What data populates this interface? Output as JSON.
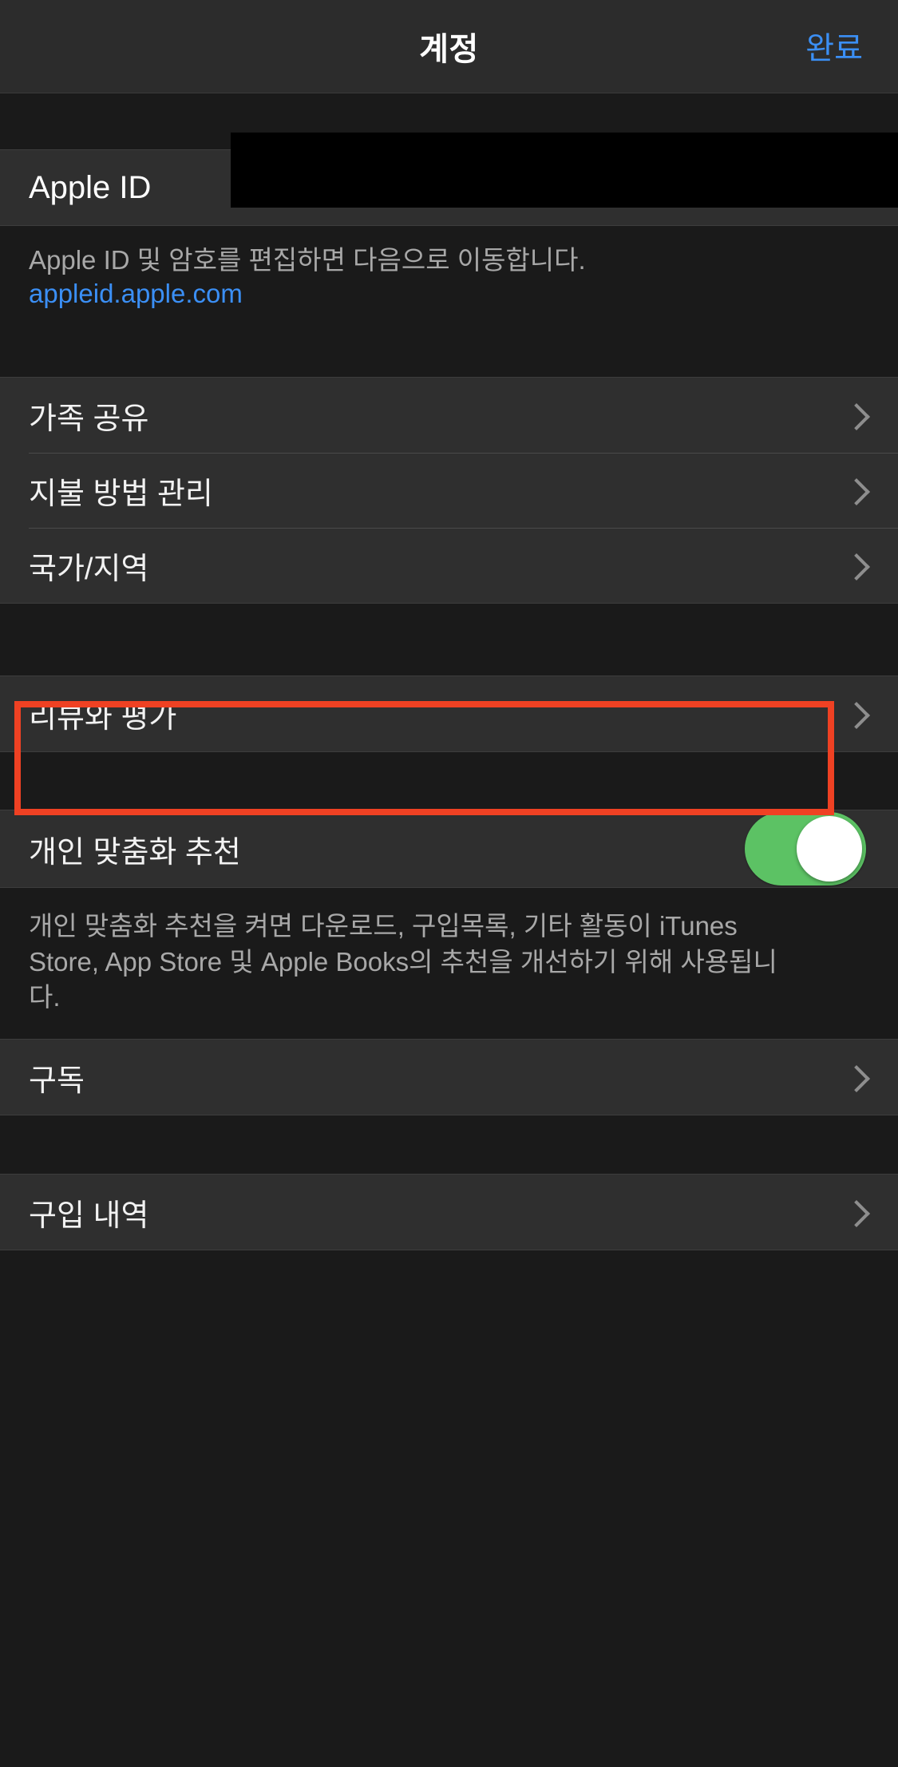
{
  "navbar": {
    "title": "계정",
    "done_label": "완료"
  },
  "account_section": {
    "apple_id_label": "Apple ID",
    "apple_id_value": "",
    "apple_id_redacted": true,
    "footnote_text": "Apple ID 및 암호를 편집하면 다음으로 이동합니다.",
    "footnote_link": "appleid.apple.com"
  },
  "settings_group_1": {
    "rows": [
      {
        "label": "가족 공유",
        "accessory": "chevron-right"
      },
      {
        "label": "지불 방법 관리",
        "accessory": "chevron-right"
      },
      {
        "label": "국가/지역",
        "accessory": "chevron-right",
        "highlighted": true
      }
    ]
  },
  "settings_group_2": {
    "rows": [
      {
        "label": "리뷰와 평가",
        "accessory": "chevron-right"
      }
    ]
  },
  "settings_group_3": {
    "rows": [
      {
        "label": "개인 맞춤화 추천",
        "accessory": "toggle",
        "toggle_on": true
      }
    ],
    "footnote": "개인 맞춤화 추천을 켜면 다운로드, 구입목록, 기타 활동이 iTunes Store, App Store 및 Apple Books의 추천을 개선하기 위해 사용됩니다."
  },
  "settings_group_4": {
    "rows": [
      {
        "label": "구독",
        "accessory": "chevron-right"
      }
    ]
  },
  "settings_group_5": {
    "rows": [
      {
        "label": "구입 내역",
        "accessory": "chevron-right"
      }
    ]
  },
  "colors": {
    "accent_blue": "#3b8ff5",
    "toggle_green": "#5cc264",
    "highlight_red": "#ef4123",
    "row_background": "#2f2f2f",
    "page_background": "#1a1a1a",
    "navbar_background": "#2c2c2c"
  }
}
